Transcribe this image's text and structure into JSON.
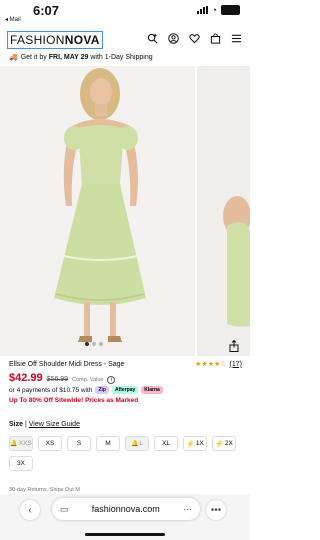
{
  "status_bar": {
    "time": "6:07",
    "battery": ""
  },
  "back_link": "◂ Mail",
  "header": {
    "logo_light": "FASHION",
    "logo_bold": "NOVA",
    "icons": [
      "plus-search-icon",
      "account-icon",
      "wishlist-icon",
      "bag-icon",
      "menu-icon"
    ]
  },
  "shipping": {
    "prefix": "Get it by ",
    "date": "FRI, MAY 29",
    "suffix": " with 1-Day Shipping"
  },
  "product": {
    "name": "Ellsie Off Shoulder Midi Dress - Sage",
    "rating_stars": "★★★★☆",
    "rating_count": "(17)",
    "price_sale": "$42.99",
    "price_original": "$56.99",
    "price_comp_label": "Comp. Value",
    "installments_text": "or 4 payments of $10.75 with",
    "pay_options": [
      "Zip",
      "Afterpay",
      "Klarna"
    ],
    "promo": "Up To 80% Off Sitewide! Prices as Marked",
    "image_dots": 3
  },
  "size": {
    "label": "Size",
    "guide": "View Size Guide",
    "options": [
      {
        "label": "XXS",
        "state": "out-of-stock"
      },
      {
        "label": "XS",
        "state": "available"
      },
      {
        "label": "S",
        "state": "available"
      },
      {
        "label": "M",
        "state": "available"
      },
      {
        "label": "L",
        "state": "out-of-stock"
      },
      {
        "label": "XL",
        "state": "available"
      },
      {
        "label": "1X",
        "state": "low-stock"
      },
      {
        "label": "2X",
        "state": "low-stock"
      },
      {
        "label": "3X",
        "state": "available"
      }
    ]
  },
  "returns_text": "30-day Returns. Ships Out M",
  "browser": {
    "url": "fashionnova.com",
    "back_icon": "‹",
    "more_icon": "•••"
  },
  "colors": {
    "sale_red": "#d0021b",
    "star_gold": "#e2a200",
    "dress_sage": "#cfdfa6",
    "address_outline": "#4a90e2"
  }
}
